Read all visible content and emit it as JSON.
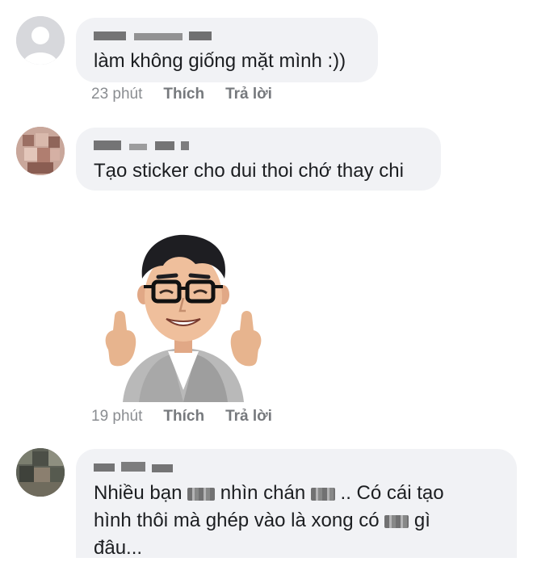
{
  "comments": [
    {
      "author": "",
      "text": "làm không giống mặt mình :))",
      "time": "23 phút",
      "like_label": "Thích",
      "reply_label": "Trả lời"
    },
    {
      "author": "",
      "text": "Tạo sticker cho dui thoi chớ thay chi",
      "time": "19 phút",
      "like_label": "Thích",
      "reply_label": "Trả lời",
      "sticker": "thumbs-up-avatar-sticker"
    },
    {
      "author": "",
      "text_line1_a": "Nhiều bạn ",
      "text_line1_b": " nhìn chán ",
      "text_line1_c": " .. Có cái tạo",
      "text_line2_a": "hình thôi mà ghép vào là xong có ",
      "text_line2_b": " gì",
      "text_line3": "đâu..."
    }
  ],
  "colors": {
    "bubble": "#f1f2f5",
    "meta": "#8a8d91",
    "text": "#1c1e21"
  }
}
